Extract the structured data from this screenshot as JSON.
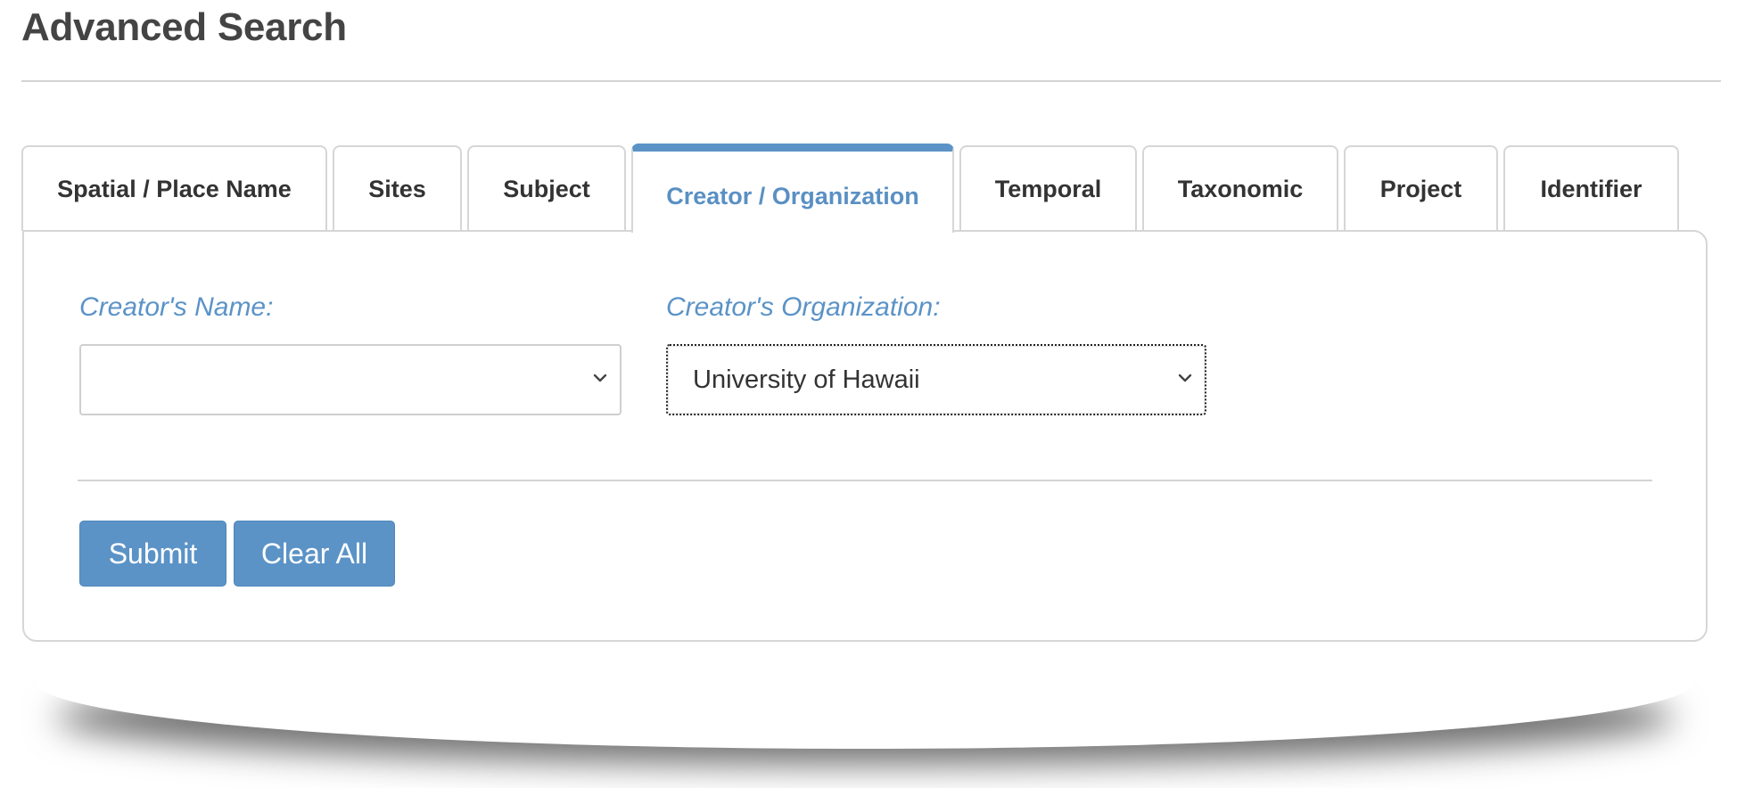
{
  "page": {
    "title": "Advanced Search"
  },
  "tabs": [
    {
      "label": "Spatial / Place Name",
      "active": false
    },
    {
      "label": "Sites",
      "active": false
    },
    {
      "label": "Subject",
      "active": false
    },
    {
      "label": "Creator / Organization",
      "active": true
    },
    {
      "label": "Temporal",
      "active": false
    },
    {
      "label": "Taxonomic",
      "active": false
    },
    {
      "label": "Project",
      "active": false
    },
    {
      "label": "Identifier",
      "active": false
    }
  ],
  "form": {
    "creator_name": {
      "label": "Creator's Name:",
      "selected_value": ""
    },
    "creator_organization": {
      "label": "Creator's Organization:",
      "selected_value": "University of Hawaii"
    }
  },
  "actions": {
    "submit_label": "Submit",
    "clear_label": "Clear All"
  },
  "colors": {
    "accent": "#5b93c7",
    "border": "#d6d6d6",
    "text": "#333333"
  },
  "icons": {
    "select_arrow": "chevron-down-icon"
  }
}
